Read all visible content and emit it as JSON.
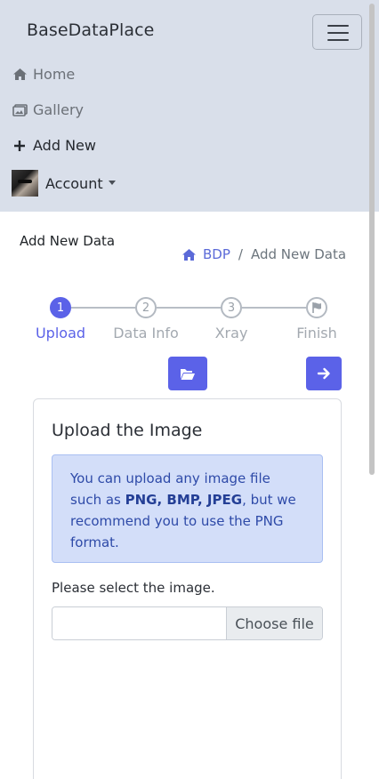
{
  "navbar": {
    "brand": "BaseDataPlace",
    "items": [
      {
        "label": "Home",
        "icon": "home-icon"
      },
      {
        "label": "Gallery",
        "icon": "gallery-icon"
      },
      {
        "label": "Add New",
        "icon": "plus-icon"
      },
      {
        "label": "Account",
        "icon": "avatar"
      }
    ]
  },
  "page": {
    "title": "Add New Data",
    "breadcrumb": {
      "home": "BDP",
      "separator": "/",
      "current": "Add New Data"
    }
  },
  "stepper": {
    "steps": [
      {
        "number": "1",
        "label": "Upload",
        "state": "active"
      },
      {
        "number": "2",
        "label": "Data Info",
        "state": "inactive"
      },
      {
        "number": "3",
        "label": "Xray",
        "state": "inactive"
      },
      {
        "number": "",
        "label": "Finish",
        "state": "inactive"
      }
    ]
  },
  "actions": {
    "browse_icon": "folder-open-icon",
    "next_icon": "arrow-right-icon"
  },
  "card": {
    "title": "Upload the Image",
    "alert_prefix": "You can upload any image file such as ",
    "alert_formats": "PNG, BMP, JPEG",
    "alert_suffix": ", but we recommend you to use the PNG format.",
    "select_label": "Please select the image.",
    "file_value": "",
    "choose_label": "Choose file"
  },
  "colors": {
    "accent": "#5b62e8",
    "navbar_bg": "#d9dfea",
    "alert_bg": "#d3def9"
  }
}
